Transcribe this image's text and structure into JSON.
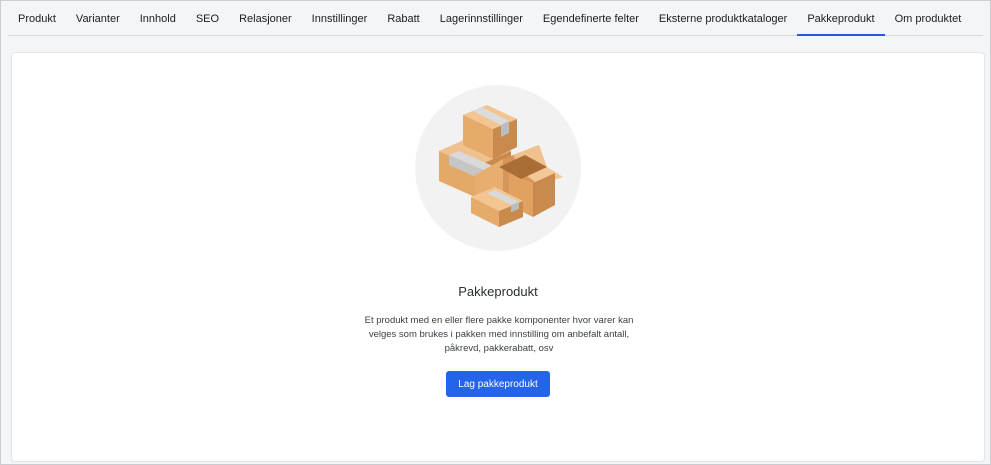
{
  "tabs": [
    {
      "label": "Produkt",
      "active": false
    },
    {
      "label": "Varianter",
      "active": false
    },
    {
      "label": "Innhold",
      "active": false
    },
    {
      "label": "SEO",
      "active": false
    },
    {
      "label": "Relasjoner",
      "active": false
    },
    {
      "label": "Innstillinger",
      "active": false
    },
    {
      "label": "Rabatt",
      "active": false
    },
    {
      "label": "Lagerinnstillinger",
      "active": false
    },
    {
      "label": "Egendefinerte felter",
      "active": false
    },
    {
      "label": "Eksterne produktkataloger",
      "active": false
    },
    {
      "label": "Pakkeprodukt",
      "active": true
    },
    {
      "label": "Om produktet",
      "active": false
    }
  ],
  "empty_state": {
    "illustration": "boxes-illustration",
    "title": "Pakkeprodukt",
    "description": "Et produkt med en eller flere pakke komponenter hvor varer kan velges som brukes i pakken med innstilling om anbefalt antall, påkrevd, pakkerabatt, osv",
    "button_label": "Lag pakkeprodukt"
  },
  "colors": {
    "accent": "#2563eb",
    "tab_underline": "#2557d6",
    "box_light": "#e8b27a",
    "box_dark": "#c98a4d",
    "tape": "#d9d9d9"
  }
}
